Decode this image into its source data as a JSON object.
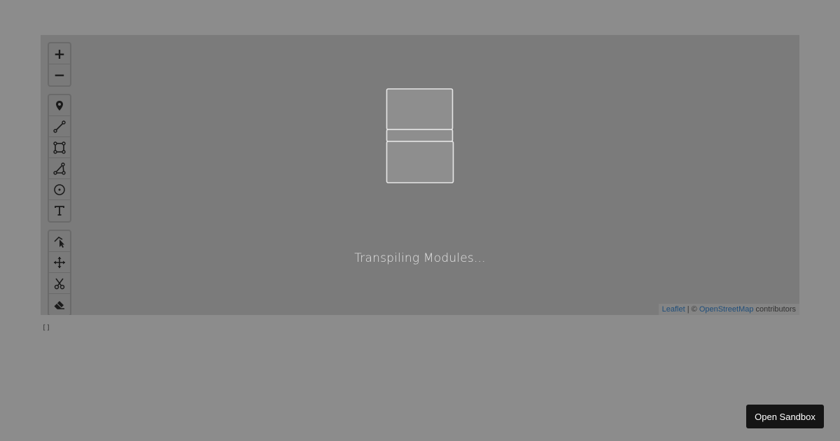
{
  "map": {
    "zoom_in_label": "+",
    "zoom_out_label": "−",
    "draw_tools": [
      "marker-icon",
      "polyline-icon",
      "rectangle-icon",
      "polygon-icon",
      "circle-icon",
      "text-icon"
    ],
    "edit_tools": [
      "edit-icon",
      "drag-icon",
      "cut-icon",
      "eraser-icon"
    ],
    "loading_text": "Transpiling Modules...",
    "attribution": {
      "leaflet_link": "Leaflet",
      "separator": " | © ",
      "osm_link": "OpenStreetMap",
      "suffix": " contributors"
    }
  },
  "output_text": "[]",
  "sandbox_button_label": "Open Sandbox",
  "colors": {
    "page_background": "#8c8c8c",
    "map_background": "#7b7b7b",
    "button_background": "#151515",
    "link": "#1f4e7a"
  }
}
